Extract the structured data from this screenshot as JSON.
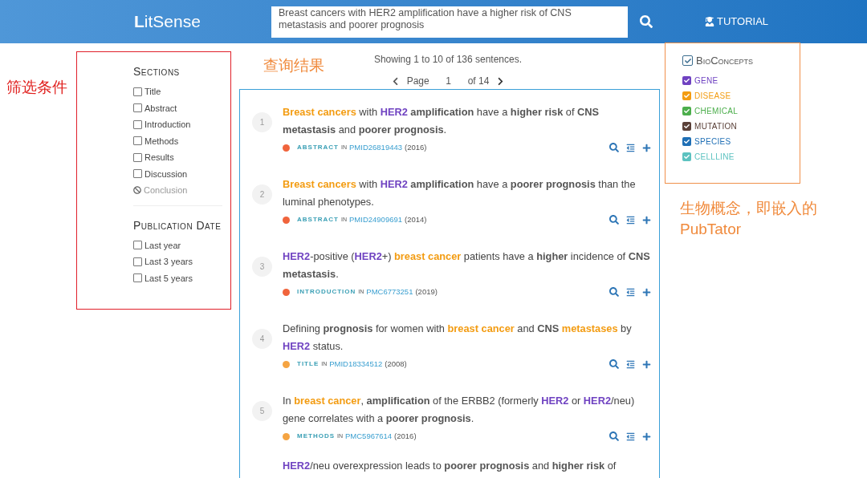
{
  "header": {
    "logo": "**L**itSense",
    "search": {
      "value": "Breast cancers with HER2 amplification have a higher risk of CNS metastasis and poorer prognosis"
    },
    "tutorial": "TUTORIAL"
  },
  "annotations": {
    "filters": "筛选条件",
    "results": "查询结果",
    "bioconcepts": "生物概念，即嵌入的 PubTator"
  },
  "filters": {
    "sections_title": "Sections",
    "sections": [
      {
        "label": "Title",
        "checked": false,
        "disabled": false
      },
      {
        "label": "Abstract",
        "checked": false,
        "disabled": false
      },
      {
        "label": "Introduction",
        "checked": false,
        "disabled": false
      },
      {
        "label": "Methods",
        "checked": false,
        "disabled": false
      },
      {
        "label": "Results",
        "checked": false,
        "disabled": false
      },
      {
        "label": "Discussion",
        "checked": false,
        "disabled": false
      },
      {
        "label": "Conclusion",
        "disabled": true
      }
    ],
    "date_title": "Publication Date",
    "dates": [
      {
        "label": "Last year",
        "checked": false
      },
      {
        "label": "Last 3 years",
        "checked": false
      },
      {
        "label": "Last 5 years",
        "checked": false
      }
    ]
  },
  "summary": "Showing 1 to 10 of 136 sentences.",
  "pagination": {
    "label": "Page",
    "value": "1",
    "total": "of 14"
  },
  "results": [
    {
      "number": "1",
      "color": "#f0643c",
      "section": "ABSTRACT",
      "in": "IN",
      "source": "PMID26819443",
      "year": "(2016)",
      "segments": [
        {
          "kind": "disease",
          "text": "Breast cancers"
        },
        {
          "kind": "plain",
          "text": " with "
        },
        {
          "kind": "gene",
          "text": "HER2"
        },
        {
          "kind": "bold",
          "text": " amplification"
        },
        {
          "kind": "plain",
          "text": " have a "
        },
        {
          "kind": "bold",
          "text": "higher risk"
        },
        {
          "kind": "plain",
          "text": " of "
        },
        {
          "kind": "bold",
          "text": "CNS metastasis"
        },
        {
          "kind": "plain",
          "text": " and "
        },
        {
          "kind": "bold",
          "text": "poorer prognosis"
        },
        {
          "kind": "plain",
          "text": "."
        }
      ]
    },
    {
      "number": "2",
      "color": "#f0643c",
      "section": "ABSTRACT",
      "in": "IN",
      "source": "PMID24909691",
      "year": "(2014)",
      "segments": [
        {
          "kind": "disease",
          "text": "Breast cancers"
        },
        {
          "kind": "plain",
          "text": " with "
        },
        {
          "kind": "gene",
          "text": "HER2"
        },
        {
          "kind": "bold",
          "text": " amplification"
        },
        {
          "kind": "plain",
          "text": " have a "
        },
        {
          "kind": "bold",
          "text": "poorer prognosis"
        },
        {
          "kind": "plain",
          "text": " than the luminal phenotypes."
        }
      ]
    },
    {
      "number": "3",
      "color": "#f0643c",
      "section": "INTRODUCTION",
      "in": "IN",
      "source": "PMC6773251",
      "year": "(2019)",
      "segments": [
        {
          "kind": "gene",
          "text": "HER2"
        },
        {
          "kind": "plain",
          "text": "-positive ("
        },
        {
          "kind": "gene",
          "text": "HER2"
        },
        {
          "kind": "plain",
          "text": "+) "
        },
        {
          "kind": "disease",
          "text": "breast cancer"
        },
        {
          "kind": "plain",
          "text": " patients have a "
        },
        {
          "kind": "bold",
          "text": "higher"
        },
        {
          "kind": "plain",
          "text": " incidence of "
        },
        {
          "kind": "bold",
          "text": "CNS metastasis"
        },
        {
          "kind": "plain",
          "text": "."
        }
      ]
    },
    {
      "number": "4",
      "color": "#f5a442",
      "section": "TITLE",
      "in": "IN",
      "source": "PMID18334512",
      "year": "(2008)",
      "segments": [
        {
          "kind": "plain",
          "text": "Defining "
        },
        {
          "kind": "bold",
          "text": "prognosis"
        },
        {
          "kind": "plain",
          "text": " for women with "
        },
        {
          "kind": "disease",
          "text": "breast cancer"
        },
        {
          "kind": "plain",
          "text": " and "
        },
        {
          "kind": "bold",
          "text": "CNS"
        },
        {
          "kind": "disease",
          "text": " metastases"
        },
        {
          "kind": "plain",
          "text": " by "
        },
        {
          "kind": "gene",
          "text": "HER2"
        },
        {
          "kind": "plain",
          "text": " status."
        }
      ]
    },
    {
      "number": "5",
      "color": "#f5a442",
      "section": "METHODS",
      "in": "IN",
      "source": "PMC5967614",
      "year": "(2016)",
      "segments": [
        {
          "kind": "plain",
          "text": "In "
        },
        {
          "kind": "disease",
          "text": "breast cancer"
        },
        {
          "kind": "plain",
          "text": ", "
        },
        {
          "kind": "bold",
          "text": "amplification"
        },
        {
          "kind": "plain",
          "text": " of the ERBB2 (formerly "
        },
        {
          "kind": "gene",
          "text": "HER2"
        },
        {
          "kind": "plain",
          "text": " or "
        },
        {
          "kind": "gene",
          "text": "HER2"
        },
        {
          "kind": "plain",
          "text": "/neu) gene correlates with a "
        },
        {
          "kind": "bold",
          "text": "poorer prognosis"
        },
        {
          "kind": "plain",
          "text": "."
        }
      ]
    }
  ],
  "partial_result": {
    "segments": [
      {
        "kind": "gene",
        "text": "HER2"
      },
      {
        "kind": "plain",
        "text": "/neu overexpression leads to "
      },
      {
        "kind": "bold",
        "text": "poorer prognosis"
      },
      {
        "kind": "plain",
        "text": " and "
      },
      {
        "kind": "bold",
        "text": "higher risk"
      },
      {
        "kind": "plain",
        "text": " of"
      }
    ]
  },
  "bioconcepts": {
    "title": "BioConcepts",
    "checked": true,
    "items": [
      {
        "label": "GENE",
        "checked": true,
        "color": "#6f42c1"
      },
      {
        "label": "DISEASE",
        "checked": true,
        "color": "#f39c12"
      },
      {
        "label": "CHEMICAL",
        "checked": true,
        "color": "#4cae4c"
      },
      {
        "label": "MUTATION",
        "checked": true,
        "color": "#5a4038"
      },
      {
        "label": "SPECIES",
        "checked": true,
        "color": "#1f6fb5"
      },
      {
        "label": "CELLLINE",
        "checked": true,
        "color": "#5cc2c0"
      }
    ]
  }
}
